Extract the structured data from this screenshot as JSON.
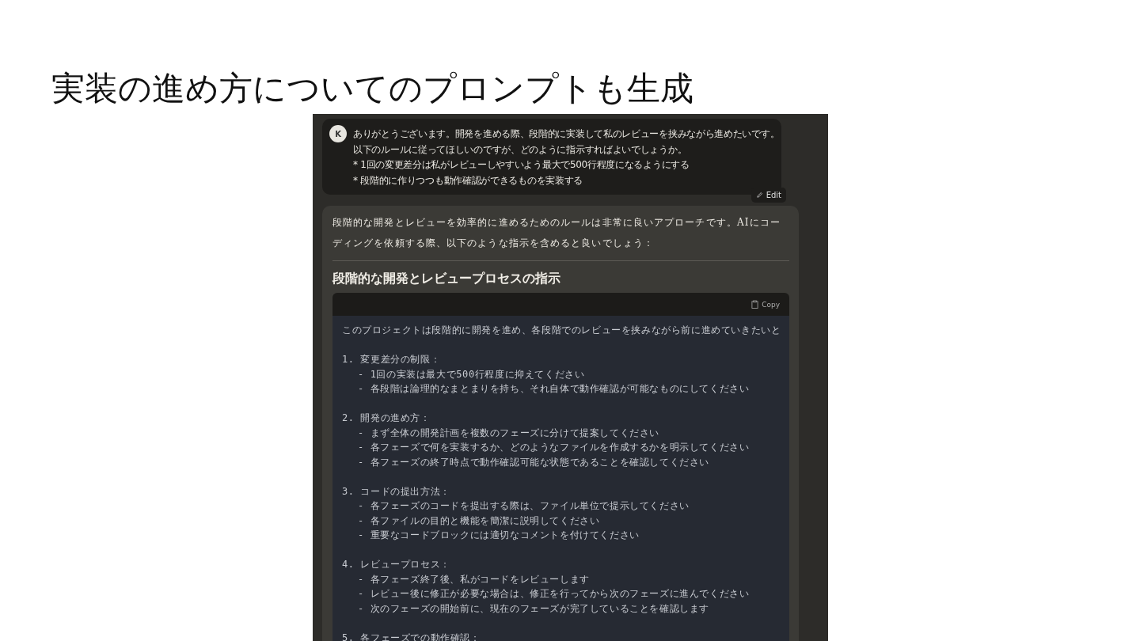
{
  "slide_title": "実装の進め方についてのプロンプトも生成",
  "chat": {
    "user_message": {
      "avatar": "K",
      "lines": [
        "ありがとうございます。開発を進める際、段階的に実装して私のレビューを挟みながら進めたいです。",
        "以下のルールに従ってほしいのですが、どのように指示すればよいでしょうか。",
        "* 1回の変更差分は私がレビューしやすいよう最大で500行程度になるようにする",
        "* 段階的に作りつつも動作確認ができるものを実装する"
      ],
      "edit_label": "Edit"
    },
    "assistant_message": {
      "intro": "段階的な開発とレビューを効率的に進めるためのルールは非常に良いアプローチです。AIにコーディングを依頼する際、以下のような指示を含めると良いでしょう：",
      "heading": "段階的な開発とレビュープロセスの指示",
      "code_block": {
        "copy_label": "Copy",
        "intro": "このプロジェクトは段階的に開発を進め、各段階でのレビューを挟みながら前に進めていきたいと",
        "sections": [
          {
            "heading": "1. 変更差分の制限：",
            "items": [
              "- 1回の実装は最大で500行程度に抑えてください",
              "- 各段階は論理的なまとまりを持ち、それ自体で動作確認が可能なものにしてください"
            ]
          },
          {
            "heading": "2. 開発の進め方：",
            "items": [
              "- まず全体の開発計画を複数のフェーズに分けて提案してください",
              "- 各フェーズで何を実装するか、どのようなファイルを作成するかを明示してください",
              "- 各フェーズの終了時点で動作確認可能な状態であることを確認してください"
            ]
          },
          {
            "heading": "3. コードの提出方法：",
            "items": [
              "- 各フェーズのコードを提出する際は、ファイル単位で提示してください",
              "- 各ファイルの目的と機能を簡潔に説明してください",
              "- 重要なコードブロックには適切なコメントを付けてください"
            ]
          },
          {
            "heading": "4. レビュープロセス：",
            "items": [
              "- 各フェーズ終了後、私がコードをレビューします",
              "- レビュー後に修正が必要な場合は、修正を行ってから次のフェーズに進んでください",
              "- 次のフェーズの開始前に、現在のフェーズが完了していることを確認します"
            ]
          },
          {
            "heading": "5. 各フェーズでの動作確認："
          }
        ]
      }
    }
  }
}
